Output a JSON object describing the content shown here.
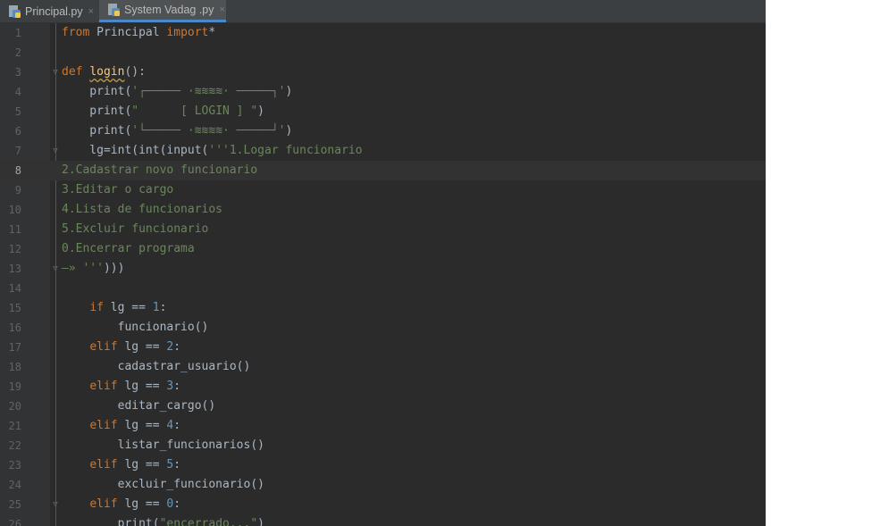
{
  "tabs": [
    {
      "label": "Principal.py",
      "icon": "python-file-icon",
      "close": "×",
      "active": false
    },
    {
      "label": "System Vadag .py",
      "icon": "python-file-icon",
      "close": "×",
      "active": true
    }
  ],
  "editor": {
    "current_line": 8,
    "lines": [
      {
        "n": "1",
        "tokens": [
          [
            "kw",
            "from "
          ],
          [
            "",
            "Principal "
          ],
          [
            "kw",
            "import"
          ],
          [
            "",
            "*"
          ]
        ]
      },
      {
        "n": "2",
        "tokens": []
      },
      {
        "n": "3",
        "tokens": [
          [
            "kw",
            "def "
          ],
          [
            "fn",
            "login"
          ],
          [
            "",
            "():"
          ]
        ]
      },
      {
        "n": "4",
        "tokens": [
          [
            "",
            "    print("
          ],
          [
            "str",
            "'┌───── ·≋≋≋≋· ─────┐'"
          ],
          [
            "",
            ")"
          ]
        ]
      },
      {
        "n": "5",
        "tokens": [
          [
            "",
            "    print("
          ],
          [
            "str",
            "\"      [ LOGIN ] \""
          ],
          [
            "",
            ")"
          ]
        ]
      },
      {
        "n": "6",
        "tokens": [
          [
            "",
            "    print("
          ],
          [
            "str",
            "'└───── ·≋≋≋≋· ─────┘'"
          ],
          [
            "",
            ")"
          ]
        ]
      },
      {
        "n": "7",
        "tokens": [
          [
            "",
            "    lg=int(int(input("
          ],
          [
            "str",
            "'''1.Logar funcionario"
          ]
        ]
      },
      {
        "n": "8",
        "tokens": [
          [
            "str",
            "2.Cadastrar novo funcionario"
          ]
        ]
      },
      {
        "n": "9",
        "tokens": [
          [
            "str",
            "3.Editar o cargo"
          ]
        ]
      },
      {
        "n": "10",
        "tokens": [
          [
            "str",
            "4.Lista de funcionarios"
          ]
        ]
      },
      {
        "n": "11",
        "tokens": [
          [
            "str",
            "5.Excluir funcionario"
          ]
        ]
      },
      {
        "n": "12",
        "tokens": [
          [
            "str",
            "0.Encerrar programa"
          ]
        ]
      },
      {
        "n": "13",
        "tokens": [
          [
            "str",
            "—» '''"
          ],
          [
            "",
            ")))"
          ]
        ]
      },
      {
        "n": "14",
        "tokens": []
      },
      {
        "n": "15",
        "tokens": [
          [
            "",
            "    "
          ],
          [
            "kw",
            "if "
          ],
          [
            "",
            "lg == "
          ],
          [
            "num",
            "1"
          ],
          [
            "",
            ":"
          ]
        ]
      },
      {
        "n": "16",
        "tokens": [
          [
            "",
            "        funcionario()"
          ]
        ]
      },
      {
        "n": "17",
        "tokens": [
          [
            "",
            "    "
          ],
          [
            "kw",
            "elif "
          ],
          [
            "",
            "lg == "
          ],
          [
            "num",
            "2"
          ],
          [
            "",
            ":"
          ]
        ]
      },
      {
        "n": "18",
        "tokens": [
          [
            "",
            "        cadastrar_usuario()"
          ]
        ]
      },
      {
        "n": "19",
        "tokens": [
          [
            "",
            "    "
          ],
          [
            "kw",
            "elif "
          ],
          [
            "",
            "lg == "
          ],
          [
            "num",
            "3"
          ],
          [
            "",
            ":"
          ]
        ]
      },
      {
        "n": "20",
        "tokens": [
          [
            "",
            "        editar_cargo()"
          ]
        ]
      },
      {
        "n": "21",
        "tokens": [
          [
            "",
            "    "
          ],
          [
            "kw",
            "elif "
          ],
          [
            "",
            "lg == "
          ],
          [
            "num",
            "4"
          ],
          [
            "",
            ":"
          ]
        ]
      },
      {
        "n": "22",
        "tokens": [
          [
            "",
            "        listar_funcionarios()"
          ]
        ]
      },
      {
        "n": "23",
        "tokens": [
          [
            "",
            "    "
          ],
          [
            "kw",
            "elif "
          ],
          [
            "",
            "lg == "
          ],
          [
            "num",
            "5"
          ],
          [
            "",
            ":"
          ]
        ]
      },
      {
        "n": "24",
        "tokens": [
          [
            "",
            "        excluir_funcionario()"
          ]
        ]
      },
      {
        "n": "25",
        "tokens": [
          [
            "",
            "    "
          ],
          [
            "kw",
            "elif "
          ],
          [
            "",
            "lg == "
          ],
          [
            "num",
            "0"
          ],
          [
            "",
            ":"
          ]
        ]
      },
      {
        "n": "26",
        "tokens": [
          [
            "",
            "        print("
          ],
          [
            "str",
            "\"encerrado...\""
          ],
          [
            "",
            ")"
          ]
        ]
      }
    ]
  },
  "colors": {
    "editor_bg": "#2b2b2b",
    "keyword": "#cc7832",
    "function_def": "#ffc66d",
    "string": "#6a8759",
    "number": "#6897bb",
    "text": "#a9b7c6"
  }
}
